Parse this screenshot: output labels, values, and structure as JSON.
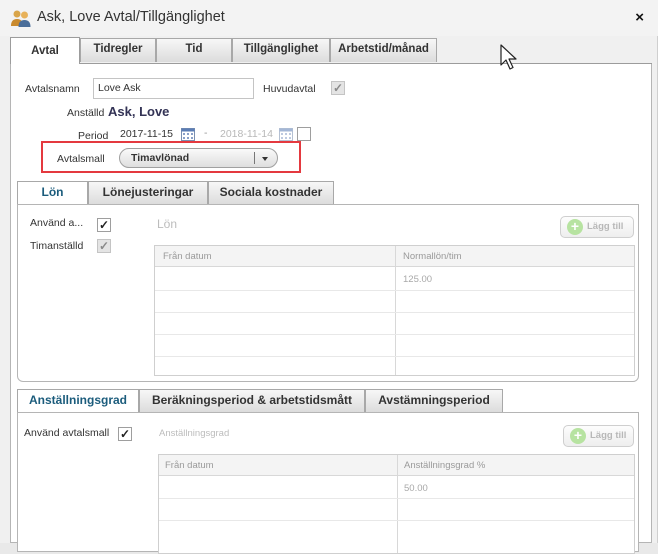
{
  "window": {
    "title": "Ask, Love Avtal/Tillgänglighet",
    "close_label": "×"
  },
  "top_tabs": [
    {
      "label": "Avtal",
      "active": true
    },
    {
      "label": "Tidregler",
      "active": false
    },
    {
      "label": "Tid",
      "active": false
    },
    {
      "label": "Tillgänglighet",
      "active": false
    },
    {
      "label": "Arbetstid/månad",
      "active": false
    }
  ],
  "form": {
    "avtalsnamn_label": "Avtalsnamn",
    "avtalsnamn_value": "Love Ask",
    "huvudavtal_label": "Huvudavtal",
    "huvudavtal_checked": true,
    "anstalld_label": "Anställd",
    "anstalld_value": "Ask, Love",
    "period_label": "Period",
    "period_from": "2017-11-15",
    "period_sep": "-",
    "period_to": "2018-11-14",
    "avtalsmall_label": "Avtalsmall",
    "avtalsmall_value": "Timavlönad",
    "highlight_color": "#e4393f"
  },
  "lon_tabs": [
    {
      "label": "Lön",
      "active": true
    },
    {
      "label": "Lönejusteringar",
      "active": false
    },
    {
      "label": "Sociala kostnader",
      "active": false
    }
  ],
  "lon": {
    "anvand_label": "Använd a...",
    "anvand_checked": true,
    "timanstalld_label": "Timanställd",
    "timanstalld_checked": true,
    "section_title": "Lön",
    "add_label": "Lägg till",
    "columns": [
      "Från datum",
      "Normallön/tim"
    ],
    "rows": [
      {
        "from": "",
        "value": "125.00"
      }
    ]
  },
  "grad_tabs": [
    {
      "label": "Anställningsgrad",
      "active": true
    },
    {
      "label": "Beräkningsperiod & arbetstidsmått",
      "active": false
    },
    {
      "label": "Avstämningsperiod",
      "active": false
    }
  ],
  "grad": {
    "anvand_label": "Använd avtalsmall",
    "anvand_checked": true,
    "section_title": "Anställningsgrad",
    "add_label": "Lägg till",
    "columns": [
      "Från datum",
      "Anställningsgrad %"
    ],
    "rows": [
      {
        "from": "",
        "value": "50.00"
      }
    ]
  },
  "icons": {
    "title": "people-icon",
    "calendar": "calendar-icon",
    "add": "plus-circle-icon",
    "dropdown": "chevron-down-icon",
    "cursor": "mouse-pointer-icon"
  }
}
